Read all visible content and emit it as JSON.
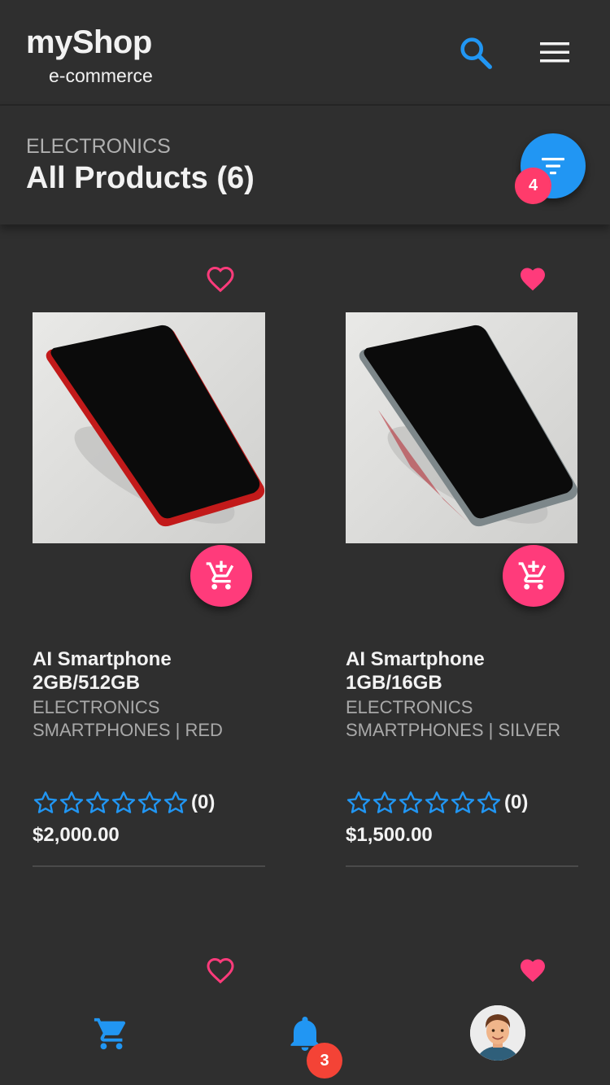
{
  "app": {
    "title": "myShop",
    "subtitle": "e-commerce"
  },
  "header": {
    "icons": {
      "search": "search-icon",
      "menu": "menu-icon"
    }
  },
  "category": {
    "label": "ELECTRONICS",
    "title": "All Products (6)",
    "filter_badge": "4"
  },
  "products": [
    {
      "name": "AI Smartphone 2GB/512GB",
      "category": "ELECTRONICS SMARTPHONES | RED",
      "rating_count": "(0)",
      "price": "$2,000.00",
      "favorited": false,
      "phone_color": "#d01d1d"
    },
    {
      "name": "AI Smartphone 1GB/16GB",
      "category": "ELECTRONICS SMARTPHONES | SILVER",
      "rating_count": "(0)",
      "price": "$1,500.00",
      "favorited": true,
      "phone_color": "#8a9396"
    },
    {
      "favorited": false
    },
    {
      "favorited": true
    }
  ],
  "bottom_nav": {
    "notification_badge": "3",
    "icons": {
      "cart": "cart-icon",
      "notifications": "bell-icon",
      "profile": "avatar"
    }
  },
  "colors": {
    "accent_blue": "#2196f3",
    "accent_pink": "#ff3b7b",
    "background": "#2f2f2f",
    "badge_red": "#f44336"
  }
}
